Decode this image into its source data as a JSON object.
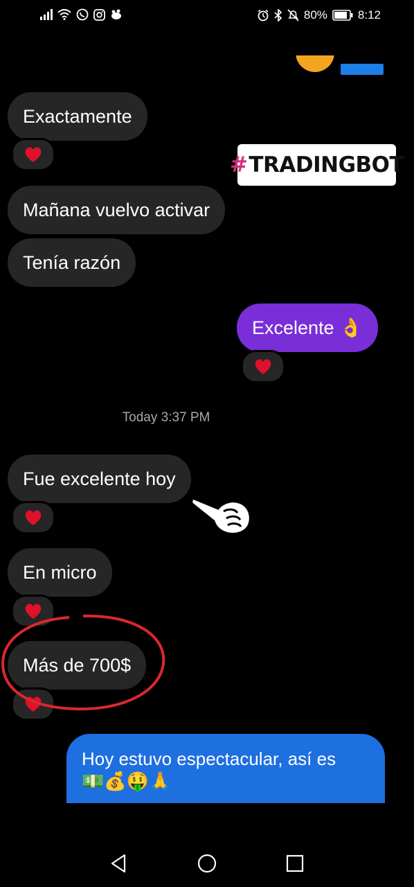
{
  "status_bar": {
    "battery": "80%",
    "time": "8:12"
  },
  "overlay_tag": {
    "hash": "#",
    "text": "TRADINGBOT"
  },
  "messages": [
    {
      "text": "Exactamente",
      "direction": "incoming",
      "reaction": "heart"
    },
    {
      "text": "Mañana vuelvo activar",
      "direction": "incoming"
    },
    {
      "text": "Tenía razón",
      "direction": "incoming"
    },
    {
      "text": "Excelente 👌",
      "direction": "outgoing",
      "reaction": "heart"
    },
    {
      "text": "Fue excelente hoy",
      "direction": "incoming",
      "reaction": "heart"
    },
    {
      "text": "En micro",
      "direction": "incoming",
      "reaction": "heart"
    },
    {
      "text": "Más de 700$",
      "direction": "incoming",
      "reaction": "heart",
      "highlighted": true
    },
    {
      "text": "Hoy estuvo espectacular, así es",
      "emoji_line": "💵💰🤑🙏",
      "direction": "outgoing"
    }
  ],
  "timestamp": "Today 3:37 PM",
  "colors": {
    "incoming_bubble": "#262626",
    "outgoing_purple": "#7a2ed8",
    "outgoing_blue": "#1e6fe0",
    "highlight_circle": "#d9282f",
    "heart": "#e0112b"
  }
}
